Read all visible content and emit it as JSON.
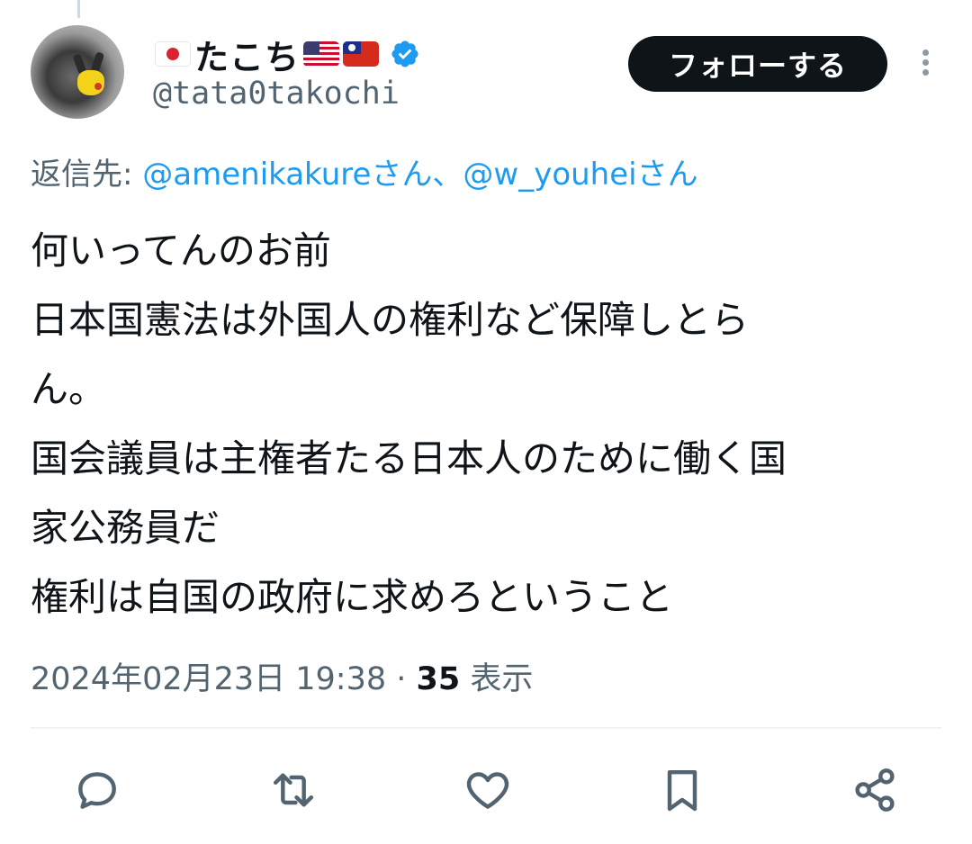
{
  "header": {
    "display_name": "たこち",
    "handle": "@tata0takochi",
    "follow_label": "フォローする"
  },
  "icons": {
    "avatar": "pikachu-avatar",
    "flag_left": "japan-flag",
    "flag_right_1": "us-flag",
    "flag_right_2": "taiwan-flag",
    "verified": "verified-badge-icon",
    "more": "more-vertical-icon"
  },
  "reply_to": {
    "prefix": "返信先: ",
    "mention1": "@amenikakure",
    "sep1": "さん、",
    "mention2": "@w_youhei",
    "sep2": "さん"
  },
  "tweet": {
    "lines": [
      "何いってんのお前",
      "日本国憲法は外国人の権利など保障しとら",
      "ん。",
      "国会議員は主権者たる日本人のために働く国",
      "家公務員だ",
      "権利は自国の政府に求めろということ"
    ]
  },
  "meta": {
    "timestamp": "2024年02月23日 19:38",
    "separator": " · ",
    "views_count": "35",
    "views_label": " 表示"
  },
  "actions": [
    "reply-icon",
    "retweet-icon",
    "like-icon",
    "bookmark-icon",
    "share-icon"
  ],
  "colors": {
    "link": "#1d9bf0",
    "secondary_text": "#536471",
    "primary_text": "#0f1419",
    "verified": "#1d9bf0",
    "button_bg": "#0f1419"
  }
}
